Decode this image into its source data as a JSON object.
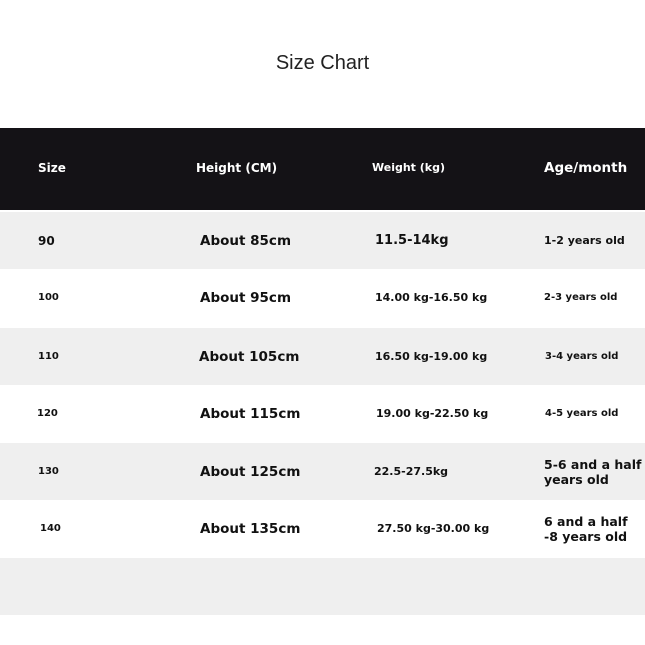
{
  "title": "Size Chart",
  "headers": {
    "size": "Size",
    "height": "Height (CM)",
    "weight": "Weight (kg)",
    "age": "Age/month"
  },
  "rows": [
    {
      "size": "90",
      "height": "About 85cm",
      "weight": "11.5-14kg",
      "age": "1-2 years old"
    },
    {
      "size": "100",
      "height": "About 95cm",
      "weight": "14.00 kg-16.50 kg",
      "age": "2-3 years old"
    },
    {
      "size": "110",
      "height": "About 105cm",
      "weight": "16.50 kg-19.00 kg",
      "age": "3-4 years old"
    },
    {
      "size": "120",
      "height": "About 115cm",
      "weight": "19.00 kg-22.50 kg",
      "age": "4-5 years old"
    },
    {
      "size": "130",
      "height": "About 125cm",
      "weight": "22.5-27.5kg",
      "age": "5-6 and a half years old"
    },
    {
      "size": "140",
      "height": "About 135cm",
      "weight": "27.50 kg-30.00 kg",
      "age": "6 and a half -8 years old"
    }
  ]
}
